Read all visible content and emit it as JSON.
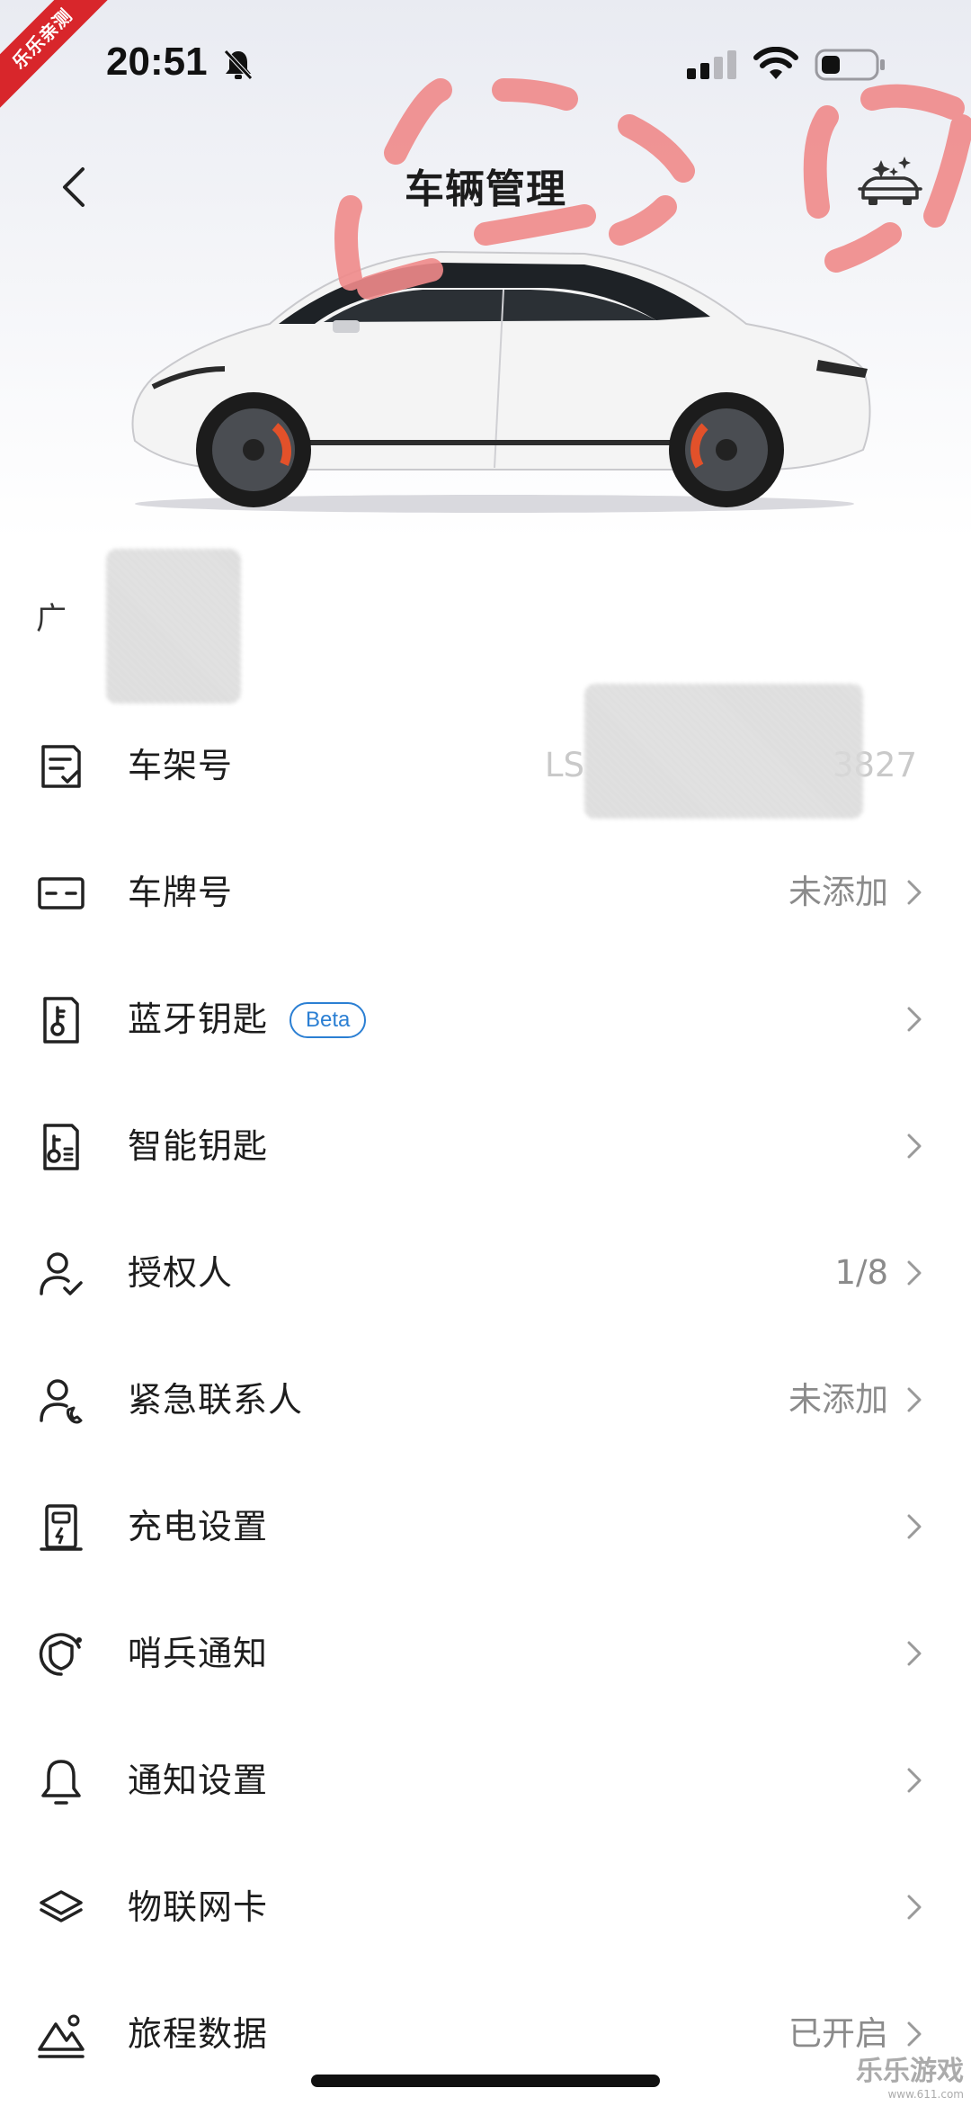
{
  "watermark": {
    "corner": "乐乐亲测",
    "bottom_right": "乐乐游戏",
    "bottom_right_url": "www.611.com"
  },
  "status_bar": {
    "time": "20:51"
  },
  "nav": {
    "title": "车辆管理"
  },
  "vehicle": {
    "name_partial": "广"
  },
  "menu": [
    {
      "label": "车架号",
      "value": "LS",
      "value_tail": "3827",
      "icon": "document-check-icon",
      "chevron": false
    },
    {
      "label": "车牌号",
      "value": "未添加",
      "icon": "license-plate-icon",
      "chevron": true
    },
    {
      "label": "蓝牙钥匙",
      "badge": "Beta",
      "value": "",
      "icon": "bluetooth-key-icon",
      "chevron": true
    },
    {
      "label": "智能钥匙",
      "value": "",
      "icon": "smart-key-icon",
      "chevron": true
    },
    {
      "label": "授权人",
      "value": "1/8",
      "icon": "user-check-icon",
      "chevron": true
    },
    {
      "label": "紧急联系人",
      "value": "未添加",
      "icon": "user-phone-icon",
      "chevron": true
    },
    {
      "label": "充电设置",
      "value": "",
      "icon": "charger-icon",
      "chevron": true
    },
    {
      "label": "哨兵通知",
      "value": "",
      "icon": "shield-icon",
      "chevron": true
    },
    {
      "label": "通知设置",
      "value": "",
      "icon": "bell-icon",
      "chevron": true
    },
    {
      "label": "物联网卡",
      "value": "",
      "icon": "layers-icon",
      "chevron": true
    },
    {
      "label": "旅程数据",
      "value": "已开启",
      "icon": "mountain-icon",
      "chevron": true
    }
  ]
}
